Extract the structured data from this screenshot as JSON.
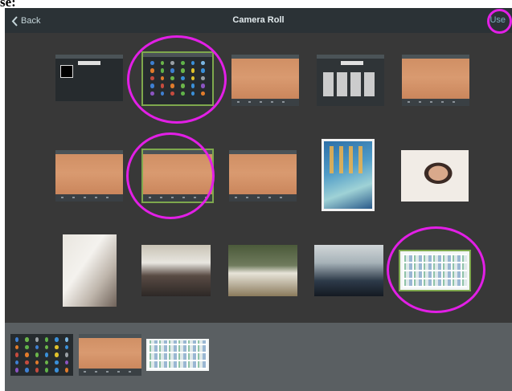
{
  "clipped_caption": "se:",
  "navbar": {
    "back_label": "Back",
    "title": "Camera Roll",
    "use_label": "Use"
  },
  "colors": {
    "annotation_circle": "#e21fe6",
    "selection_border": "#7ea84d",
    "navbar_bg": "#2b3236",
    "screen_bg": "#383838",
    "tray_bg": "#5a5f62"
  },
  "grid_rows": [
    [
      "dark-panel",
      "icon-grid-selected",
      "peach-toolbar",
      "swatch-panel",
      "peach-toolbar"
    ],
    [
      "peach-toolbar",
      "peach-toolbar-selected",
      "peach-toolbar",
      "ipad-homescreen",
      "face-photo"
    ],
    [
      "paper-photo",
      "classroom-photo",
      "table-photo",
      "group-photo",
      "tile-grid-selected"
    ]
  ],
  "tray_items": [
    "icon-grid",
    "peach-toolbar",
    "tile-grid"
  ]
}
